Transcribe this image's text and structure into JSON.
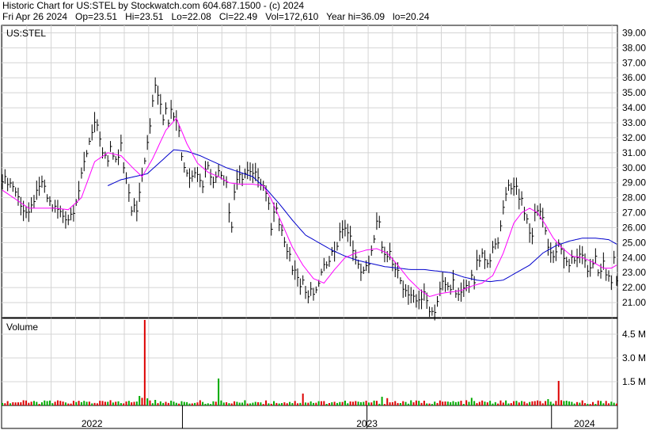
{
  "header": {
    "line1": "Historic Chart for US:STEL by Stockwatch.com 604.687.1500 - (c) 2024",
    "line2": "Fri Apr 26 2024   Op=23.51   Hi=23.51   Lo=22.08   Cl=22.49   Vol=172,610   Year hi=36.09   lo=20.24"
  },
  "chart_data": [
    {
      "type": "line",
      "label": "US:STEL",
      "ylim": [
        20.0,
        39.5
      ],
      "y_ticks": [
        "39.00",
        "38.00",
        "37.00",
        "36.00",
        "35.00",
        "34.00",
        "33.00",
        "32.00",
        "31.00",
        "30.00",
        "29.00",
        "28.00",
        "27.00",
        "26.00",
        "25.00",
        "24.00",
        "23.00",
        "22.00",
        "21.00"
      ],
      "x_labels": [
        "2022",
        "2023",
        "2024"
      ],
      "grid": true,
      "colors": {
        "price": "#000000",
        "ma_short": "#ff00ff",
        "ma_long": "#0000cc"
      },
      "anchors": [
        [
          0,
          29.3
        ],
        [
          2,
          29.1
        ],
        [
          4,
          28.8
        ],
        [
          6,
          28.0
        ],
        [
          8,
          27.2
        ],
        [
          10,
          26.8
        ],
        [
          12,
          27.9
        ],
        [
          14,
          28.6
        ],
        [
          15,
          29.1
        ],
        [
          17,
          28.0
        ],
        [
          19,
          27.4
        ],
        [
          21,
          27.2
        ],
        [
          23,
          26.8
        ],
        [
          25,
          26.6
        ],
        [
          27,
          27.2
        ],
        [
          29,
          28.5
        ],
        [
          31,
          30.3
        ],
        [
          33,
          31.8
        ],
        [
          34,
          32.5
        ],
        [
          35,
          33.0
        ],
        [
          36,
          32.6
        ],
        [
          37,
          31.7
        ],
        [
          38,
          31.0
        ],
        [
          40,
          30.4
        ],
        [
          41,
          31.2
        ],
        [
          42,
          30.8
        ],
        [
          44,
          30.6
        ],
        [
          45,
          31.5
        ],
        [
          46,
          30.1
        ],
        [
          48,
          28.5
        ],
        [
          49,
          27.3
        ],
        [
          50,
          27.6
        ],
        [
          51,
          27.3
        ],
        [
          52,
          28.2
        ],
        [
          53,
          29.5
        ],
        [
          55,
          31.5
        ],
        [
          56,
          32.8
        ],
        [
          57,
          34.6
        ],
        [
          58,
          35.6
        ],
        [
          59,
          35.0
        ],
        [
          60,
          34.4
        ],
        [
          61,
          33.4
        ],
        [
          62,
          33.8
        ],
        [
          63,
          33.2
        ],
        [
          64,
          34.1
        ],
        [
          65,
          33.6
        ],
        [
          67,
          32.6
        ],
        [
          68,
          30.8
        ],
        [
          69,
          30.1
        ],
        [
          70,
          29.7
        ],
        [
          71,
          29.3
        ],
        [
          72,
          29.6
        ],
        [
          73,
          29.9
        ],
        [
          74,
          29.7
        ],
        [
          75,
          29.1
        ],
        [
          76,
          28.9
        ],
        [
          77,
          29.8
        ],
        [
          78,
          30.3
        ],
        [
          79,
          29.6
        ],
        [
          80,
          28.9
        ],
        [
          81,
          29.4
        ],
        [
          82,
          30.0
        ],
        [
          83,
          29.6
        ],
        [
          85,
          29.1
        ],
        [
          86,
          27.0
        ],
        [
          87,
          26.1
        ],
        [
          88,
          28.4
        ],
        [
          89,
          29.0
        ],
        [
          90,
          29.4
        ],
        [
          91,
          29.4
        ],
        [
          92,
          29.6
        ],
        [
          93,
          29.7
        ],
        [
          95,
          29.5
        ],
        [
          97,
          29.5
        ],
        [
          98,
          29.1
        ],
        [
          99,
          28.8
        ],
        [
          100,
          28.4
        ],
        [
          101,
          27.4
        ],
        [
          102,
          26.1
        ],
        [
          103,
          27.2
        ],
        [
          104,
          27.3
        ],
        [
          105,
          26.0
        ],
        [
          106,
          25.9
        ],
        [
          107,
          25.0
        ],
        [
          108,
          24.3
        ],
        [
          109,
          24.0
        ],
        [
          110,
          23.3
        ],
        [
          112,
          22.9
        ],
        [
          113,
          22.3
        ],
        [
          114,
          22.5
        ],
        [
          115,
          21.7
        ],
        [
          116,
          21.4
        ],
        [
          117,
          21.7
        ],
        [
          118,
          21.6
        ],
        [
          119,
          21.6
        ],
        [
          120,
          22.4
        ],
        [
          121,
          22.9
        ],
        [
          122,
          23.3
        ],
        [
          123,
          23.7
        ],
        [
          124,
          24.0
        ],
        [
          125,
          24.3
        ],
        [
          126,
          24.5
        ],
        [
          127,
          24.9
        ],
        [
          128,
          25.5
        ],
        [
          129,
          26.0
        ],
        [
          130,
          26.0
        ],
        [
          131,
          25.5
        ],
        [
          132,
          25.3
        ],
        [
          133,
          24.7
        ],
        [
          134,
          24.0
        ],
        [
          135,
          23.4
        ],
        [
          136,
          23.2
        ],
        [
          137,
          23.0
        ],
        [
          138,
          23.3
        ],
        [
          139,
          23.7
        ],
        [
          140,
          24.5
        ],
        [
          141,
          25.1
        ],
        [
          142,
          26.3
        ],
        [
          143,
          26.2
        ],
        [
          144,
          24.9
        ],
        [
          145,
          24.1
        ],
        [
          146,
          23.9
        ],
        [
          147,
          24.2
        ],
        [
          148,
          23.5
        ],
        [
          149,
          23.2
        ],
        [
          151,
          22.7
        ],
        [
          152,
          22.1
        ],
        [
          153,
          21.7
        ],
        [
          155,
          21.3
        ],
        [
          157,
          21.1
        ],
        [
          158,
          21.3
        ],
        [
          159,
          21.3
        ],
        [
          160,
          21.5
        ],
        [
          161,
          21.1
        ],
        [
          162,
          20.6
        ],
        [
          163,
          20.4
        ],
        [
          164,
          20.5
        ],
        [
          165,
          21.1
        ],
        [
          166,
          21.8
        ],
        [
          167,
          22.3
        ],
        [
          168,
          22.2
        ],
        [
          169,
          22.0
        ],
        [
          170,
          22.1
        ],
        [
          171,
          22.4
        ],
        [
          172,
          21.4
        ],
        [
          173,
          21.4
        ],
        [
          174,
          21.7
        ],
        [
          175,
          21.9
        ],
        [
          176,
          22.3
        ],
        [
          177,
          22.1
        ],
        [
          178,
          22.6
        ],
        [
          179,
          22.4
        ],
        [
          180,
          23.6
        ],
        [
          181,
          23.8
        ],
        [
          182,
          24.2
        ],
        [
          183,
          23.7
        ],
        [
          185,
          24.0
        ],
        [
          186,
          24.5
        ],
        [
          187,
          24.8
        ],
        [
          188,
          25.0
        ],
        [
          189,
          26.3
        ],
        [
          190,
          27.3
        ],
        [
          191,
          28.4
        ],
        [
          192,
          28.8
        ],
        [
          193,
          28.8
        ],
        [
          194,
          28.5
        ],
        [
          195,
          28.7
        ],
        [
          196,
          28.0
        ],
        [
          197,
          27.8
        ],
        [
          198,
          27.1
        ],
        [
          199,
          26.6
        ],
        [
          200,
          25.6
        ],
        [
          201,
          25.6
        ],
        [
          202,
          27.0
        ],
        [
          203,
          27.2
        ],
        [
          204,
          26.9
        ],
        [
          205,
          26.6
        ],
        [
          206,
          25.9
        ],
        [
          207,
          24.5
        ],
        [
          208,
          24.1
        ],
        [
          209,
          24.1
        ],
        [
          210,
          24.5
        ],
        [
          211,
          25.1
        ],
        [
          212,
          24.4
        ],
        [
          213,
          23.8
        ],
        [
          214,
          23.7
        ],
        [
          215,
          23.6
        ],
        [
          216,
          23.8
        ],
        [
          217,
          24.0
        ],
        [
          218,
          23.8
        ],
        [
          219,
          24.3
        ],
        [
          220,
          24.1
        ],
        [
          221,
          23.8
        ],
        [
          222,
          23.2
        ],
        [
          223,
          23.2
        ],
        [
          224,
          23.6
        ],
        [
          225,
          24.1
        ],
        [
          226,
          23.2
        ],
        [
          227,
          23.1
        ],
        [
          228,
          23.6
        ],
        [
          229,
          22.9
        ],
        [
          230,
          22.6
        ],
        [
          231,
          22.3
        ],
        [
          232,
          23.9
        ],
        [
          233,
          22.5
        ]
      ],
      "ma_short": [
        [
          0,
          28.5
        ],
        [
          10,
          27.3
        ],
        [
          20,
          27.3
        ],
        [
          25,
          27.2
        ],
        [
          30,
          28.0
        ],
        [
          35,
          30.4
        ],
        [
          40,
          31.0
        ],
        [
          45,
          30.8
        ],
        [
          50,
          29.9
        ],
        [
          53,
          29.4
        ],
        [
          57,
          30.6
        ],
        [
          62,
          32.5
        ],
        [
          66,
          33.3
        ],
        [
          70,
          31.6
        ],
        [
          74,
          30.3
        ],
        [
          78,
          29.7
        ],
        [
          82,
          29.4
        ],
        [
          86,
          29.0
        ],
        [
          90,
          28.9
        ],
        [
          95,
          28.9
        ],
        [
          99,
          28.8
        ],
        [
          102,
          27.9
        ],
        [
          106,
          26.3
        ],
        [
          110,
          24.7
        ],
        [
          114,
          23.5
        ],
        [
          118,
          22.6
        ],
        [
          122,
          22.3
        ],
        [
          126,
          23.2
        ],
        [
          130,
          24.0
        ],
        [
          134,
          24.3
        ],
        [
          138,
          24.5
        ],
        [
          142,
          24.6
        ],
        [
          146,
          24.3
        ],
        [
          150,
          23.5
        ],
        [
          154,
          22.6
        ],
        [
          158,
          21.9
        ],
        [
          162,
          21.4
        ],
        [
          166,
          21.6
        ],
        [
          170,
          21.7
        ],
        [
          174,
          21.8
        ],
        [
          178,
          22.1
        ],
        [
          182,
          22.3
        ],
        [
          186,
          22.8
        ],
        [
          190,
          24.3
        ],
        [
          194,
          26.3
        ],
        [
          197,
          27.0
        ],
        [
          200,
          27.3
        ],
        [
          203,
          27.0
        ],
        [
          206,
          26.2
        ],
        [
          209,
          25.3
        ],
        [
          212,
          24.7
        ],
        [
          216,
          24.1
        ],
        [
          220,
          24.0
        ],
        [
          224,
          23.7
        ],
        [
          228,
          23.3
        ],
        [
          231,
          23.3
        ],
        [
          233,
          23.5
        ]
      ],
      "ma_long": [
        [
          40,
          28.8
        ],
        [
          45,
          29.2
        ],
        [
          50,
          29.4
        ],
        [
          55,
          29.6
        ],
        [
          60,
          30.4
        ],
        [
          65,
          31.2
        ],
        [
          70,
          31.1
        ],
        [
          75,
          30.8
        ],
        [
          80,
          30.4
        ],
        [
          85,
          30.0
        ],
        [
          90,
          29.7
        ],
        [
          95,
          29.4
        ],
        [
          100,
          28.6
        ],
        [
          105,
          27.6
        ],
        [
          110,
          26.5
        ],
        [
          115,
          25.5
        ],
        [
          120,
          25.0
        ],
        [
          125,
          24.5
        ],
        [
          130,
          24.1
        ],
        [
          135,
          23.8
        ],
        [
          140,
          23.6
        ],
        [
          145,
          23.4
        ],
        [
          150,
          23.3
        ],
        [
          155,
          23.2
        ],
        [
          160,
          23.2
        ],
        [
          165,
          23.1
        ],
        [
          170,
          23.0
        ],
        [
          175,
          22.7
        ],
        [
          180,
          22.5
        ],
        [
          185,
          22.4
        ],
        [
          190,
          22.5
        ],
        [
          195,
          23.0
        ],
        [
          200,
          23.5
        ],
        [
          205,
          24.3
        ],
        [
          210,
          24.8
        ],
        [
          215,
          25.1
        ],
        [
          220,
          25.3
        ],
        [
          225,
          25.3
        ],
        [
          230,
          25.2
        ],
        [
          233,
          24.9
        ]
      ]
    },
    {
      "type": "bar",
      "label": "Volume",
      "ylim": [
        0,
        5500000
      ],
      "y_ticks": [
        "4.5 M",
        "3.0 M",
        "1.5 M"
      ],
      "colors": {
        "up": "#00aa00",
        "down": "#dd0000"
      },
      "base_volume": 220000,
      "spikes": [
        {
          "x": 54,
          "value": 5400000,
          "color": "#dd0000"
        },
        {
          "x": 52,
          "value": 600000,
          "color": "#00aa00"
        },
        {
          "x": 53,
          "value": 480000,
          "color": "#dd0000"
        },
        {
          "x": 55,
          "value": 450000,
          "color": "#00aa00"
        },
        {
          "x": 58,
          "value": 350000,
          "color": "#00aa00"
        },
        {
          "x": 82,
          "value": 1700000,
          "color": "#00aa00"
        },
        {
          "x": 114,
          "value": 750000,
          "color": "#dd0000"
        },
        {
          "x": 144,
          "value": 550000,
          "color": "#00aa00"
        },
        {
          "x": 146,
          "value": 460000,
          "color": "#dd0000"
        },
        {
          "x": 178,
          "value": 480000,
          "color": "#00aa00"
        },
        {
          "x": 211,
          "value": 1550000,
          "color": "#dd0000"
        },
        {
          "x": 207,
          "value": 400000,
          "color": "#00aa00"
        }
      ]
    }
  ]
}
